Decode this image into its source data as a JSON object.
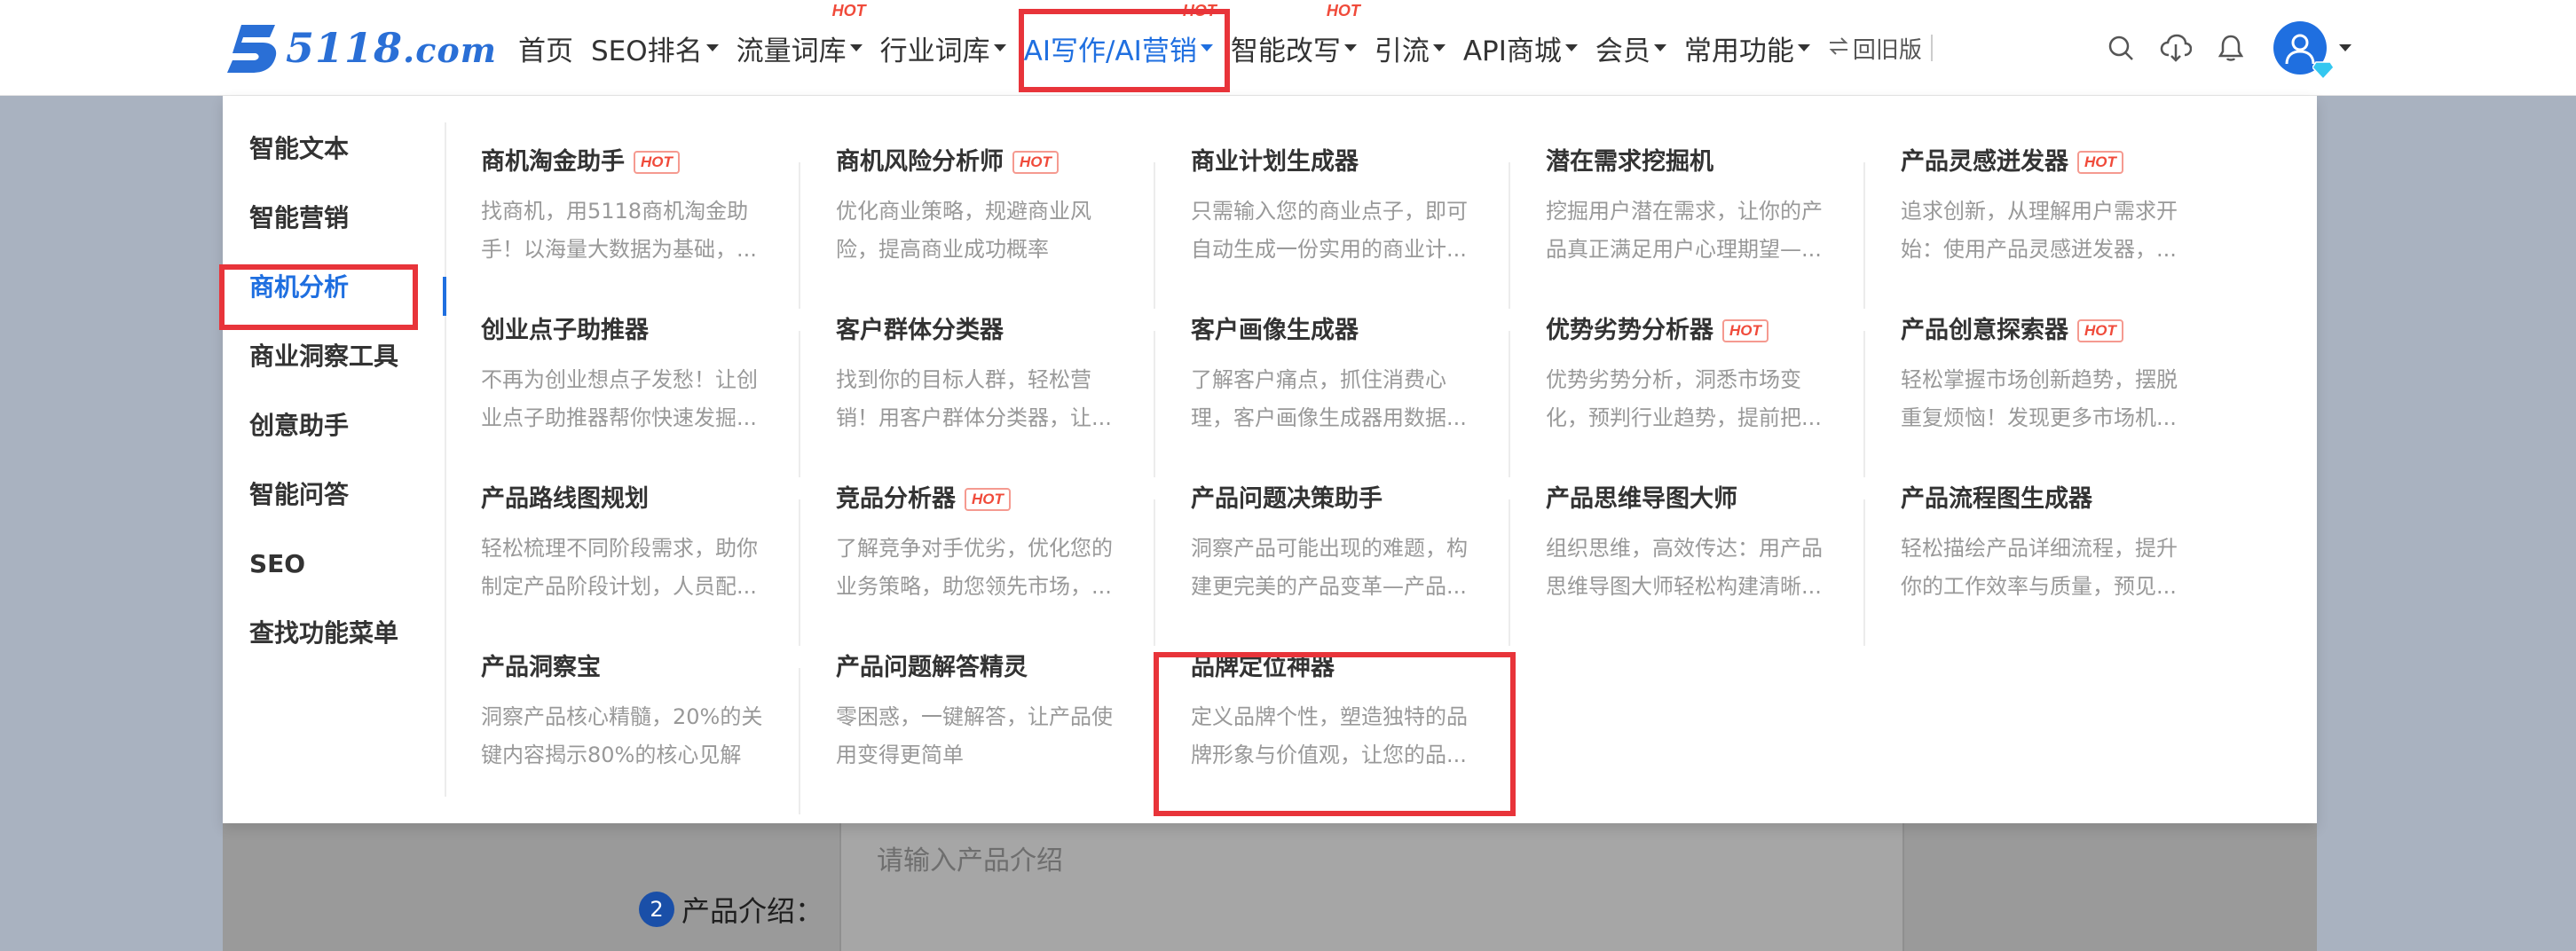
{
  "header": {
    "logo": {
      "number": "5118",
      "suffix": ".com"
    },
    "nav": [
      {
        "label": "首页",
        "hot": "",
        "caret": false,
        "active": false
      },
      {
        "label": "SEO排名",
        "hot": "",
        "caret": true,
        "active": false
      },
      {
        "label": "流量词库",
        "hot": "HOT",
        "caret": true,
        "active": false
      },
      {
        "label": "行业词库",
        "hot": "",
        "caret": true,
        "active": false
      },
      {
        "label": "AI写作/AI营销",
        "hot": "HOT",
        "caret": true,
        "active": true
      },
      {
        "label": "智能改写",
        "hot": "HOT",
        "caret": true,
        "active": false
      },
      {
        "label": "引流",
        "hot": "",
        "caret": true,
        "active": false
      },
      {
        "label": "API商城",
        "hot": "",
        "caret": true,
        "active": false
      },
      {
        "label": "会员",
        "hot": "",
        "caret": true,
        "active": false
      },
      {
        "label": "常用功能",
        "hot": "",
        "caret": true,
        "active": false
      }
    ],
    "switch_label": "回旧版",
    "icons": [
      "search-icon",
      "cloud-download-icon",
      "bell-icon",
      "avatar-icon"
    ]
  },
  "dropdown": {
    "sidebar": [
      {
        "label": "智能文本",
        "active": false
      },
      {
        "label": "智能营销",
        "active": false
      },
      {
        "label": "商机分析",
        "active": true
      },
      {
        "label": "商业洞察工具",
        "active": false
      },
      {
        "label": "创意助手",
        "active": false
      },
      {
        "label": "智能问答",
        "active": false
      },
      {
        "label": "SEO",
        "active": false
      },
      {
        "label": "查找功能菜单",
        "active": false
      }
    ],
    "cards": [
      {
        "title": "商机淘金助手",
        "hot": "HOT",
        "desc": "找商机，用5118商机淘金助手！以海量大数据为基础，..."
      },
      {
        "title": "商机风险分析师",
        "hot": "HOT",
        "desc": "优化商业策略，规避商业风险，提高商业成功概率"
      },
      {
        "title": "商业计划生成器",
        "hot": "",
        "desc": "只需输入您的商业点子，即可自动生成一份实用的商业计..."
      },
      {
        "title": "潜在需求挖掘机",
        "hot": "",
        "desc": "挖掘用户潜在需求，让你的产品真正满足用户心理期望—..."
      },
      {
        "title": "产品灵感迸发器",
        "hot": "HOT",
        "desc": "追求创新，从理解用户需求开始：使用产品灵感迸发器，..."
      },
      {
        "title": "创业点子助推器",
        "hot": "",
        "desc": "不再为创业想点子发愁！让创业点子助推器帮你快速发掘..."
      },
      {
        "title": "客户群体分类器",
        "hot": "",
        "desc": "找到你的目标人群，轻松营销！用客户群体分类器，让..."
      },
      {
        "title": "客户画像生成器",
        "hot": "",
        "desc": "了解客户痛点，抓住消费心理，客户画像生成器用数据..."
      },
      {
        "title": "优势劣势分析器",
        "hot": "HOT",
        "desc": "优势劣势分析，洞悉市场变化，预判行业趋势，提前把..."
      },
      {
        "title": "产品创意探索器",
        "hot": "HOT",
        "desc": "轻松掌握市场创新趋势，摆脱重复烦恼！发现更多市场机..."
      },
      {
        "title": "产品路线图规划",
        "hot": "",
        "desc": "轻松梳理不同阶段需求，助你制定产品阶段计划，人员配..."
      },
      {
        "title": "竞品分析器",
        "hot": "HOT",
        "desc": "了解竞争对手优劣，优化您的业务策略，助您领先市场，..."
      },
      {
        "title": "产品问题决策助手",
        "hot": "",
        "desc": "洞察产品可能出现的难题，构建更完美的产品变革—产品..."
      },
      {
        "title": "产品思维导图大师",
        "hot": "",
        "desc": "组织思维，高效传达：用产品思维导图大师轻松构建清晰..."
      },
      {
        "title": "产品流程图生成器",
        "hot": "",
        "desc": "轻松描绘产品详细流程，提升你的工作效率与质量，预见..."
      },
      {
        "title": "产品洞察宝",
        "hot": "",
        "desc": "洞察产品核心精髓，20%的关键内容揭示80%的核心见解"
      },
      {
        "title": "产品问题解答精灵",
        "hot": "",
        "desc": "零困惑，一键解答，让产品使用变得更简单"
      },
      {
        "title": "品牌定位神器",
        "hot": "",
        "desc": "定义品牌个性，塑造独特的品牌形象与价值观，让您的品..."
      }
    ]
  },
  "background": {
    "placeholder": "请输入产品介绍",
    "step_number": "2",
    "field_label": "产品介绍："
  },
  "colors": {
    "accent": "#1f6fe0",
    "hot": "#f04a3a",
    "highlight": "#e8343a"
  }
}
